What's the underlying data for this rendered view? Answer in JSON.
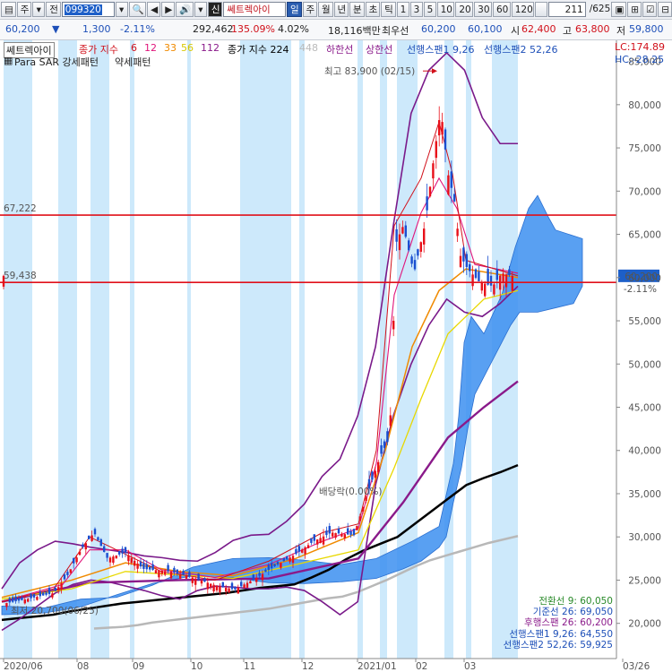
{
  "toolbar": {
    "b_list": "▤",
    "b_type": "주",
    "b_type_arrow": "▾",
    "b_prev": "전",
    "code": "099320",
    "b_code_arrow": "▾",
    "b_search": "🔍",
    "b_s1": "◀",
    "b_s2": "▶",
    "b_sound": "🔊",
    "b_sound_arrow": "▾",
    "b_sin": "신",
    "name": "쎄트렉아이",
    "periods": [
      "일",
      "주",
      "월",
      "년",
      "분",
      "초",
      "틱"
    ],
    "numbers": [
      "1",
      "3",
      "5",
      "10",
      "20",
      "30",
      "60",
      "120"
    ],
    "count": "211",
    "total": "/625",
    "icons": [
      "▣",
      "⊞",
      "☑",
      "⊟"
    ]
  },
  "info": {
    "price": "60,200",
    "arrow": "▼",
    "change": "1,300",
    "pct": "-2.11%",
    "volume": "292,462",
    "vol_rate": "135.09%",
    "turnover": "4.02%",
    "amount": "18,116백만",
    "best_label": "최우선",
    "best_ask": "60,200",
    "best_bid": "60,100",
    "open_label": "시",
    "open": "62,400",
    "high_label": "고",
    "high": "63,800",
    "low_label": "저",
    "low": "59,800"
  },
  "legend": {
    "name": "쎄트렉아이",
    "ma_label": "종가 지수",
    "ma6": "6",
    "ma12": "12",
    "ma33": "33",
    "ma56": "56",
    "ma112": "112",
    "ma224_label": "종가 지수 224",
    "ma448": "448",
    "lower_band": "하한선",
    "upper_band": "상한선",
    "span1": "선행스팬1 9,26",
    "span2": "선행스팬2 52,26",
    "sar_label": "Para SAR 강세패턴",
    "sar_weak": "약세패턴",
    "lc": "LC:174.89",
    "hc": "HC:-28.25"
  },
  "annotations": {
    "high": "최고 83,900 (02/15)",
    "dividend": "배당락(0.00%)",
    "low": "최저 20,700(06/25)",
    "hline_top": "67,222",
    "hline_bottom": "59,438",
    "price_box": "60,200",
    "price_pct": "-2.11%"
  },
  "values_box": [
    {
      "label": "전환선 9: 60,050",
      "color": "#2a8a2a"
    },
    {
      "label": "기준선 26: 69,050",
      "color": "#1d4fb8"
    },
    {
      "label": "후행스팬 26: 60,200",
      "color": "#8a1a8a"
    },
    {
      "label": "선행스팬1 9,26: 64,550",
      "color": "#1d4fb8"
    },
    {
      "label": "선행스팬2 52,26: 59,925",
      "color": "#1d4fb8"
    }
  ],
  "chart_data": {
    "type": "line",
    "ylim": [
      18000,
      89000
    ],
    "y_ticks": [
      20000,
      25000,
      30000,
      35000,
      40000,
      45000,
      50000,
      55000,
      60000,
      65000,
      70000,
      75000,
      80000,
      85000
    ],
    "x_labels": [
      "2020/06",
      "08",
      "09",
      "10",
      "11",
      "12",
      "2021/01",
      "02",
      "03",
      "03/26"
    ],
    "hlines": [
      67222,
      59438
    ],
    "current_price": 60200,
    "high": {
      "value": 83900,
      "date": "02/15"
    },
    "low": {
      "value": 20700,
      "date": "06/25"
    },
    "weekly_close": [
      22500,
      22800,
      23200,
      24500,
      29000,
      30500,
      27500,
      26500,
      25600,
      26300,
      25900,
      25000,
      24800,
      24400,
      23900,
      24800,
      26200,
      26800,
      28500,
      29800,
      30300,
      29600,
      30200,
      36500,
      41500,
      66500,
      68500,
      79500,
      70500,
      61200,
      59000,
      58800,
      61500,
      60200
    ],
    "series": [
      {
        "name": "종가 지수 224",
        "values": [
          20400,
          20600,
          20800,
          21000,
          21400,
          21700,
          22000,
          22300,
          22500,
          22700,
          22900,
          23100,
          23300,
          23500,
          23800,
          24100,
          24300,
          24500,
          25300,
          26200,
          27400,
          28400,
          29200,
          30000,
          31500,
          33000,
          34500,
          36000,
          36800,
          37500,
          38300
        ]
      },
      {
        "name": "종가 지수 448",
        "values": [
          19400,
          19500,
          19600,
          19800,
          20100,
          20300,
          20500,
          20700,
          20900,
          21100,
          21300,
          21500,
          21700,
          22000,
          22300,
          22600,
          22900,
          23100,
          23600,
          24300,
          25000,
          25800,
          26600,
          27300,
          27800,
          28300,
          28800,
          29300,
          29700,
          30100
        ]
      },
      {
        "name": "상한선",
        "values": [
          24000,
          27000,
          28500,
          29500,
          29200,
          28800,
          28500,
          28200,
          27800,
          27600,
          27300,
          27200,
          28200,
          29600,
          30200,
          30300,
          31800,
          33800,
          37000,
          39000,
          44000,
          52000,
          66000,
          79000,
          84000,
          86000,
          84000,
          78500,
          75500,
          75500
        ]
      },
      {
        "name": "하한선",
        "values": [
          19200,
          20500,
          22000,
          23500,
          24500,
          25000,
          24800,
          24300,
          23800,
          23200,
          22800,
          23800,
          24300,
          24200,
          24000,
          24000,
          24200,
          23800,
          22500,
          21000,
          22500,
          36000,
          44000,
          50000,
          54500,
          57500,
          56000,
          55500,
          57000,
          59000
        ]
      }
    ]
  }
}
